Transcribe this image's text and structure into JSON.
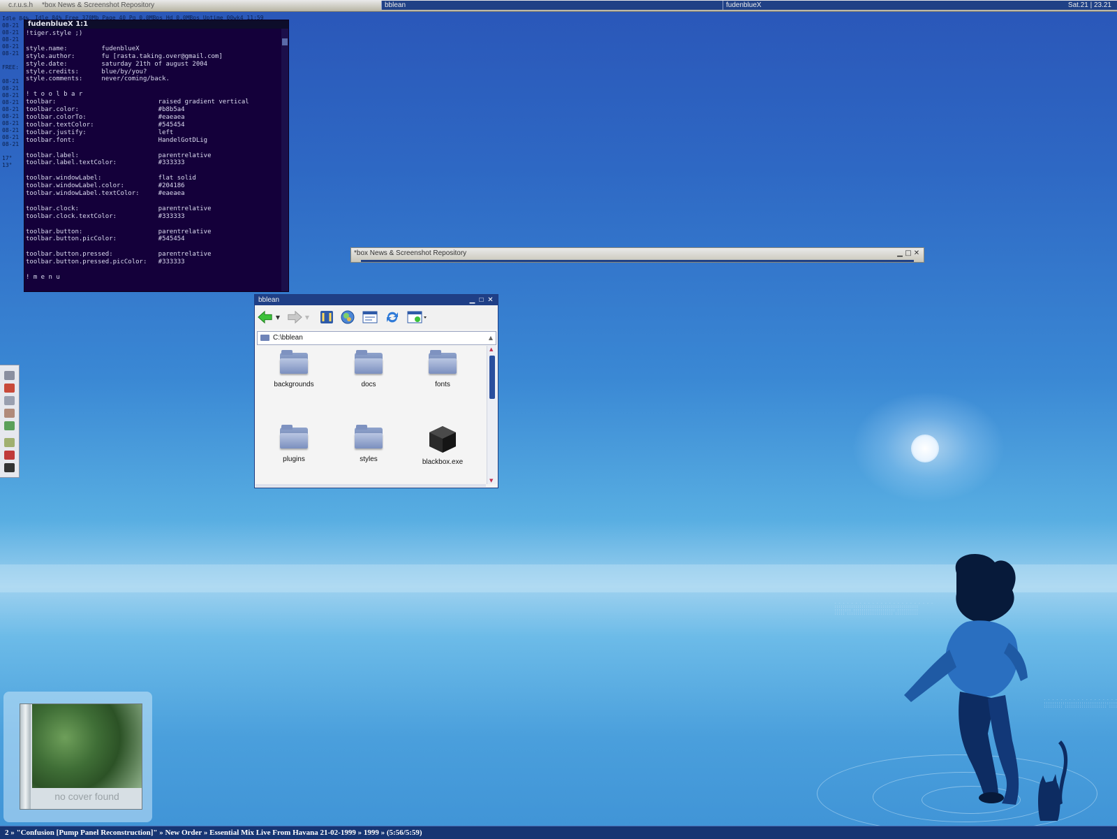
{
  "toolbar": {
    "workspace": "c.r.u.s.h",
    "window_label": "*box News & Screenshot Repository",
    "task1": "bblean",
    "task2": "fudenblueX",
    "clock": "Sat.21 | 23.21"
  },
  "sysinfo": {
    "top_line": "Idle 84%   Free 370Mb   Page 40   Pg 0.0MBps   Hd 0.0MBps   Uptime 00wk4 11:59",
    "left_lines": [
      "Idle 84%",
      "08-21",
      "08-21",
      "08-21",
      "08-21",
      "08-21",
      "",
      "FREE:",
      "",
      "08-21",
      "08-21",
      "08-21",
      "08-21",
      "08-21",
      "08-21",
      "08-21",
      "08-21",
      "08-21",
      "08-21",
      "",
      "17°",
      "13°"
    ]
  },
  "terminal": {
    "title": "fudenblueX  1:1",
    "lines": [
      "!tiger.style ;)",
      "",
      "style.name:         fudenblueX",
      "style.author:       fu [rasta.taking.over@gmail.com]",
      "style.date:         saturday 21th of august 2004",
      "style.credits:      blue/by/you?",
      "style.comments:     never/coming/back.",
      "",
      "! t o o l b a r",
      "toolbar:                           raised gradient vertical",
      "toolbar.color:                     #b8b5a4",
      "toolbar.colorTo:                   #eaeaea",
      "toolbar.textColor:                 #545454",
      "toolbar.justify:                   left",
      "toolbar.font:                      HandelGotDLig",
      "",
      "toolbar.label:                     parentrelative",
      "toolbar.label.textColor:           #333333",
      "",
      "toolbar.windowLabel:               flat solid",
      "toolbar.windowLabel.color:         #204186",
      "toolbar.windowLabel.textColor:     #eaeaea",
      "",
      "toolbar.clock:                     parentrelative",
      "toolbar.clock.textColor:           #333333",
      "",
      "toolbar.button:                    parentrelative",
      "toolbar.button.picColor:           #545454",
      "",
      "toolbar.button.pressed:            parentrelative",
      "toolbar.button.pressed.picColor:   #333333",
      "",
      "! m e n u"
    ]
  },
  "news_window": {
    "title": "*box News & Screenshot Repository",
    "buttons": [
      "minimize",
      "maximize",
      "close"
    ]
  },
  "explorer": {
    "title": "bblean",
    "address": "C:\\bblean",
    "toolbar_icons": [
      "back-arrow-icon",
      "forward-arrow-icon",
      "folders-icon",
      "globe-icon",
      "view-icon",
      "refresh-icon",
      "new-window-icon"
    ],
    "items": [
      {
        "label": "backgrounds",
        "icon": "folder-icon"
      },
      {
        "label": "docs",
        "icon": "folder-icon"
      },
      {
        "label": "fonts",
        "icon": "folder-icon"
      },
      {
        "label": "plugins",
        "icon": "folder-icon"
      },
      {
        "label": "styles",
        "icon": "folder-icon"
      },
      {
        "label": "blackbox.exe",
        "icon": "cube-icon"
      }
    ]
  },
  "slit_icons": [
    "joystick-icon",
    "printer-icon",
    "phone-icon",
    "figure-icon",
    "picture-icon",
    "flower-icon",
    "book-icon",
    "barcode-icon"
  ],
  "cover": {
    "caption": "no cover found"
  },
  "now_playing": "2 » \"Confusion [Pump Panel Reconstruction]\" » New Order » Essential Mix Live From Havana 21-02-1999 » 1999 » (5:56/5:59)",
  "colors": {
    "toolbar": "#b8b5a4",
    "toolbar_to": "#eaeaea",
    "window_label": "#204186",
    "terminal_bg": "#14003a"
  }
}
